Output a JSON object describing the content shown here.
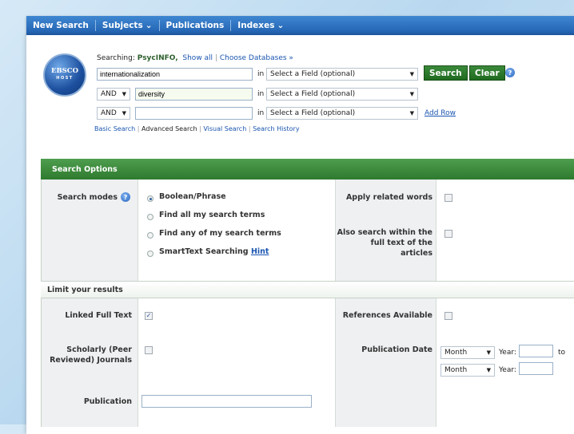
{
  "topnav": {
    "new_search": "New Search",
    "subjects": "Subjects",
    "publications": "Publications",
    "indexes": "Indexes"
  },
  "logo": {
    "name": "EBSCO",
    "sub": "HOST"
  },
  "search": {
    "searching_label": "Searching:",
    "database": "PsycINFO,",
    "show_all": "Show all",
    "choose_databases": "Choose Databases »",
    "rows": [
      {
        "bool": "",
        "term": "internationalization",
        "in": "in",
        "field": "Select a Field (optional)"
      },
      {
        "bool": "AND",
        "term": "diversity",
        "in": "in",
        "field": "Select a Field (optional)"
      },
      {
        "bool": "AND",
        "term": "",
        "in": "in",
        "field": "Select a Field (optional)"
      }
    ],
    "search_button": "Search",
    "clear_button": "Clear",
    "add_row": "Add Row",
    "links": [
      "Basic Search",
      "Advanced Search",
      "Visual Search",
      "Search History"
    ]
  },
  "options": {
    "header": "Search Options",
    "search_modes_label": "Search modes",
    "modes": [
      "Boolean/Phrase",
      "Find all my search terms",
      "Find any of my search terms",
      "SmartText Searching"
    ],
    "selected_mode": "Boolean/Phrase",
    "hint": "Hint",
    "apply_related": "Apply related words",
    "also_search": "Also search within the full text of the articles"
  },
  "limits": {
    "header": "Limit your results",
    "linked_full_text": "Linked Full Text",
    "linked_full_text_checked": true,
    "references_available": "References Available",
    "scholarly": "Scholarly (Peer Reviewed) Journals",
    "publication_date": "Publication Date",
    "month": "Month",
    "year": "Year:",
    "to": "to",
    "publication": "Publication"
  },
  "colors": {
    "nav_blue": "#1f5fae",
    "green": "#2e7a2e",
    "link": "#1a55b0"
  }
}
